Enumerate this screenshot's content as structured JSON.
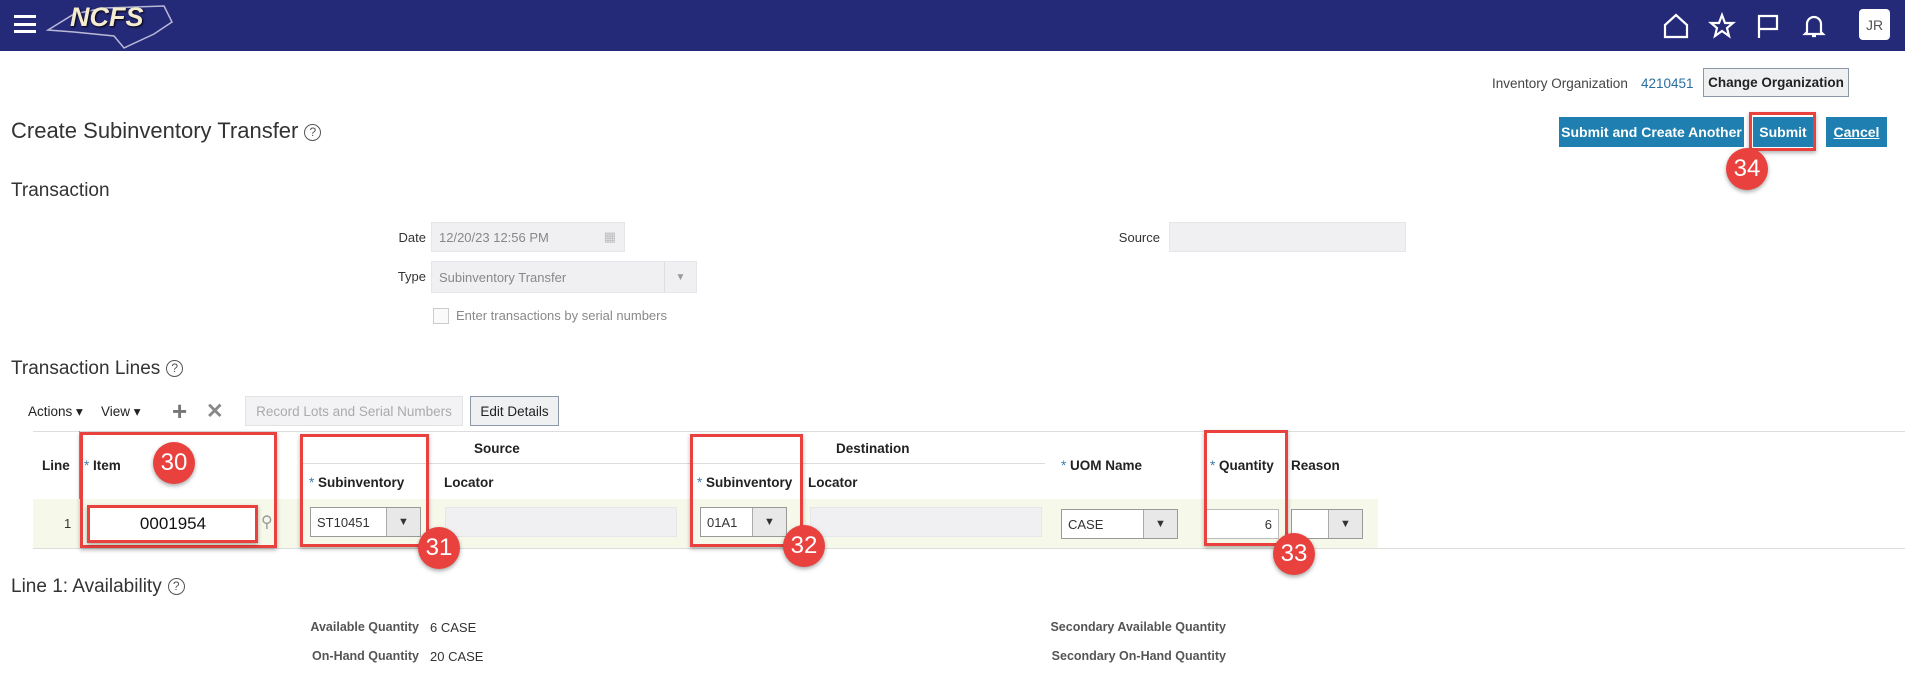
{
  "header": {
    "logo_text": "NCFS",
    "avatar": "JR",
    "icons": [
      "menu-icon",
      "home-icon",
      "star-icon",
      "flag-icon",
      "bell-icon"
    ]
  },
  "org": {
    "label": "Inventory Organization",
    "value": "4210451",
    "change_button": "Change Organization"
  },
  "page": {
    "title": "Create Subinventory Transfer",
    "help": "?"
  },
  "actions": {
    "submit_another": "Submit and Create Another",
    "submit": "Submit",
    "cancel": "Cancel"
  },
  "transaction": {
    "heading": "Transaction",
    "date_label": "Date",
    "date_value": "12/20/23 12:56 PM",
    "source_label": "Source",
    "source_value": "",
    "type_label": "Type",
    "type_value": "Subinventory Transfer",
    "serial_checkbox": "Enter transactions by serial numbers"
  },
  "lines": {
    "heading": "Transaction Lines",
    "toolbar": {
      "actions": "Actions ▾",
      "view": "View ▾",
      "record_lots": "Record Lots and Serial Numbers",
      "edit_details": "Edit Details"
    },
    "columns": {
      "line": "Line",
      "item": "Item",
      "source_group": "Source",
      "destination_group": "Destination",
      "subinventory": "Subinventory",
      "locator": "Locator",
      "uom": "UOM Name",
      "quantity": "Quantity",
      "reason": "Reason"
    },
    "rows": [
      {
        "line": "1",
        "item": "0001954",
        "source_subinventory": "ST10451",
        "source_locator": "",
        "dest_subinventory": "01A1",
        "dest_locator": "",
        "uom": "CASE",
        "quantity": "6",
        "reason": ""
      }
    ]
  },
  "availability": {
    "heading": "Line 1: Availability",
    "available_label": "Available Quantity",
    "available_value": "6 CASE",
    "onhand_label": "On-Hand Quantity",
    "onhand_value": "20 CASE",
    "sec_available_label": "Secondary Available Quantity",
    "sec_onhand_label": "Secondary On-Hand Quantity"
  },
  "callouts": [
    "30",
    "31",
    "32",
    "33",
    "34"
  ],
  "colors": {
    "header": "#252a78",
    "button": "#1f7fb0",
    "callout": "#e8413e"
  }
}
